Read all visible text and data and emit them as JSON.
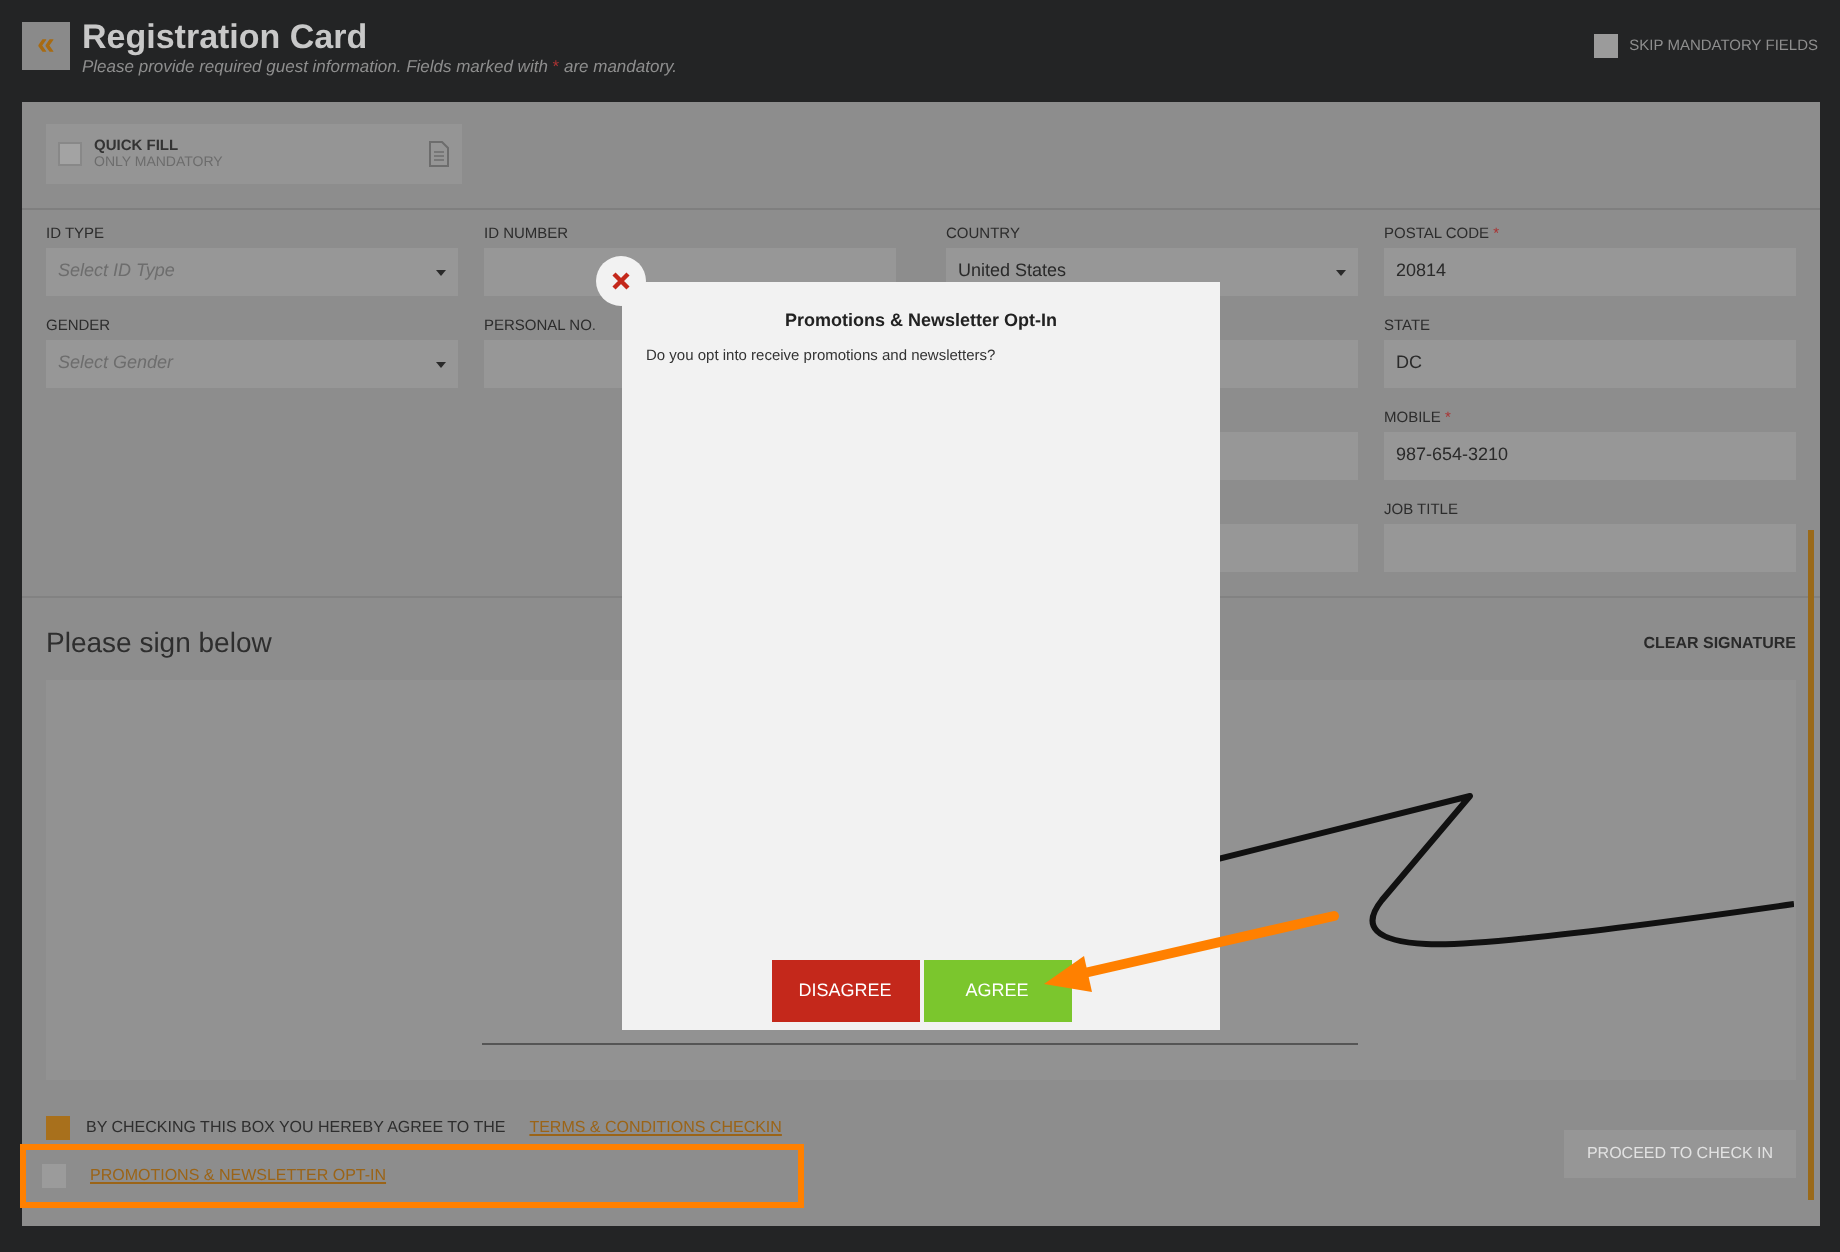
{
  "header": {
    "back_icon": "«",
    "title": "Registration Card",
    "subtitle_before": "Please provide required guest information. Fields marked with",
    "subtitle_mark": "*",
    "subtitle_after": "are mandatory.",
    "skip_mandatory": {
      "label": "SKIP MANDATORY FIELDS",
      "checked": false
    }
  },
  "quick_fill": {
    "title": "QUICK FILL",
    "subtitle": "ONLY MANDATORY",
    "checked": false
  },
  "field_columns": [
    [
      {
        "label": "ID TYPE",
        "kind": "select",
        "placeholder": "Select ID Type"
      },
      {
        "label": "GENDER",
        "kind": "select",
        "placeholder": "Select Gender"
      }
    ],
    [
      {
        "label": "ID NUMBER",
        "kind": "text"
      },
      {
        "label": "PERSONAL NO.",
        "kind": "text"
      }
    ],
    [
      {
        "label": "COUNTRY",
        "kind": "select",
        "value": "United States"
      },
      {
        "kind": "text"
      },
      {
        "kind": "text"
      },
      {
        "kind": "text"
      }
    ],
    [
      {
        "label": "POSTAL CODE",
        "required_mark": "*",
        "kind": "text",
        "value": "20814"
      },
      {
        "label": "STATE",
        "kind": "text",
        "value": "DC"
      },
      {
        "label": "MOBILE",
        "required_mark": "*",
        "kind": "text",
        "value": "987-654-3210"
      },
      {
        "label": "JOB TITLE",
        "kind": "text"
      }
    ]
  ],
  "signature": {
    "heading": "Please sign below",
    "clear_label": "CLEAR SIGNATURE"
  },
  "consents": [
    {
      "text": "BY CHECKING THIS BOX YOU HEREBY AGREE TO THE",
      "link": "TERMS & CONDITIONS CHECKIN",
      "checked": true,
      "highlighted": false
    },
    {
      "link": "PROMOTIONS & NEWSLETTER OPT-IN",
      "checked": false,
      "highlighted": true
    }
  ],
  "proceed_button": {
    "label": "PROCEED TO CHECK IN",
    "disabled": true
  },
  "modal": {
    "title": "Promotions & Newsletter Opt-In",
    "message": "Do you opt into receive promotions and newsletters?",
    "buttons": [
      {
        "label": "DISAGREE",
        "kind": "danger"
      },
      {
        "label": "AGREE",
        "kind": "success"
      }
    ]
  }
}
